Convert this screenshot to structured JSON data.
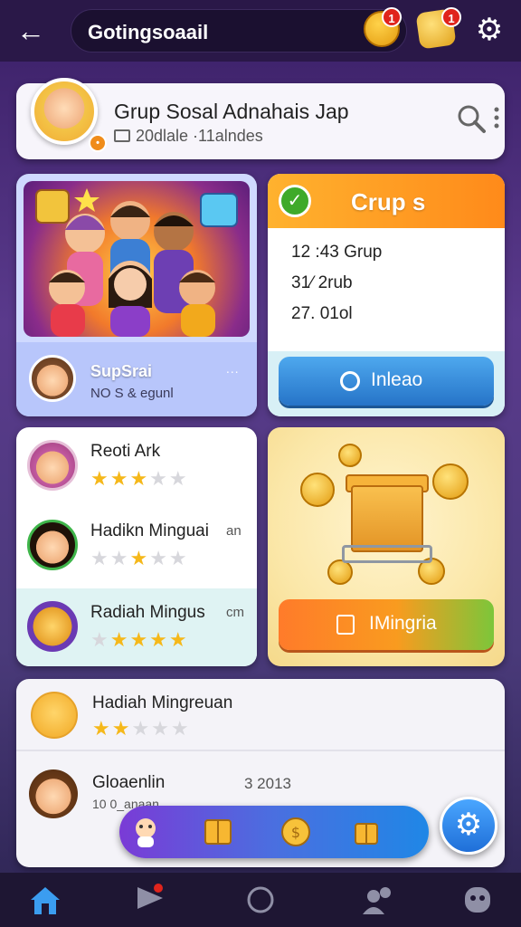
{
  "topbar": {
    "search_text": "Gotingsoaail",
    "badge_coins": "1",
    "badge_chat": "1"
  },
  "group_header": {
    "title": "Grup Sosal Adnahais Jap",
    "subtitle": "20dlale ·11alndes"
  },
  "photo_card": {
    "name": "SupSrai",
    "sub": "NO S & egunl",
    "dots": "∙∙∙"
  },
  "stats_card": {
    "title": "Crup s",
    "lines": [
      "12 :43 Grup",
      "31⁄ 2rub",
      "27. 01ol"
    ],
    "button_label": "Inleao"
  },
  "list": {
    "items": [
      {
        "name": "Reoti Ark",
        "meta": "",
        "stars": 3
      },
      {
        "name": "Hadikn Minguai",
        "meta": "an",
        "stars": 1
      },
      {
        "name": "Radiah Mingus",
        "meta": "cm",
        "stars": 4
      }
    ]
  },
  "reward_card": {
    "button_label": "IMingria"
  },
  "bottom_card": {
    "row1_name": "Hadiah Mingreuan",
    "row1_stars": 2,
    "row2_name": "Gloaenlin",
    "row2_value": "3 2013",
    "row2_sub": "10 0_anaan"
  },
  "colors": {
    "accent_orange": "#ff8a1a",
    "accent_blue": "#2674c8",
    "star": "#f5b81a",
    "badge_red": "#e0241c"
  }
}
